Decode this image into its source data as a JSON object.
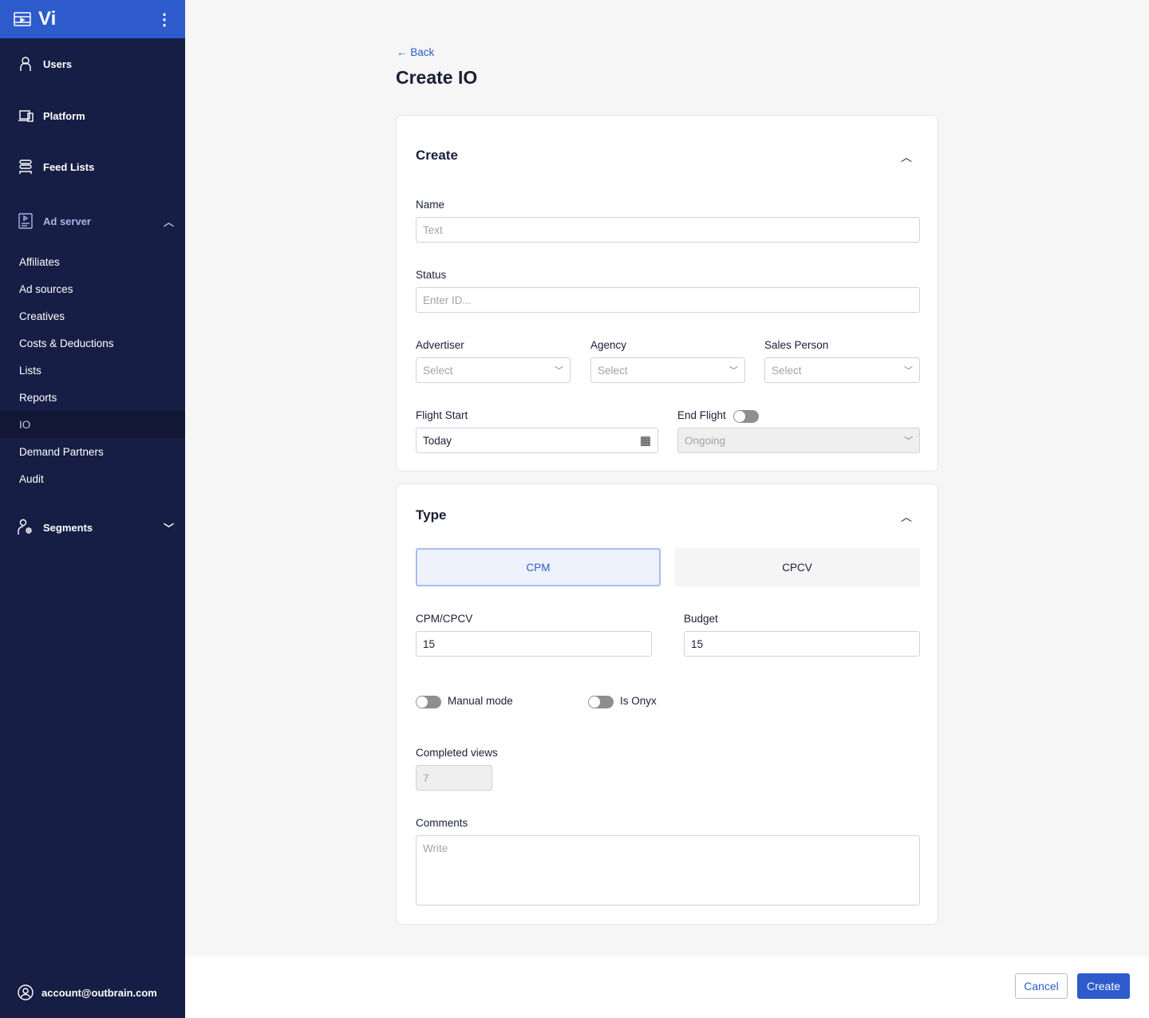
{
  "app": {
    "title": "Vi"
  },
  "sidebar": {
    "main": [
      {
        "label": "Users"
      },
      {
        "label": "Platform"
      },
      {
        "label": "Feed Lists"
      },
      {
        "label": "Ad server"
      },
      {
        "label": "Segments"
      }
    ],
    "sub": [
      "Affiliates",
      "Ad sources",
      "Creatives",
      "Costs & Deductions",
      "Lists",
      "Reports",
      "IO",
      "Demand Partners",
      "Audit"
    ],
    "active": "IO",
    "account": "account@outbrain.com"
  },
  "page": {
    "back": "← Back",
    "title": "Create IO"
  },
  "create": {
    "title": "Create",
    "name": {
      "label": "Name",
      "placeholder": "Text"
    },
    "status": {
      "label": "Status",
      "placeholder": "Enter ID..."
    },
    "advertiser": {
      "label": "Advertiser",
      "placeholder": "Select"
    },
    "agency": {
      "label": "Agency",
      "placeholder": "Select"
    },
    "sales": {
      "label": "Sales Person",
      "placeholder": "Select"
    },
    "flight_start": {
      "label": "Flight Start",
      "value": "Today"
    },
    "end_flight": {
      "label": "End Flight",
      "value": "Ongoing",
      "enabled": false
    }
  },
  "type": {
    "title": "Type",
    "options": [
      "CPM",
      "CPCV"
    ],
    "selected": "CPM",
    "cpm": {
      "label": "CPM/CPCV",
      "value": "15"
    },
    "budget": {
      "label": "Budget",
      "value": "15"
    },
    "manual": {
      "label": "Manual mode",
      "on": false
    },
    "onyx": {
      "label": "Is Onyx",
      "on": false
    },
    "completed": {
      "label": "Completed views",
      "value": "7"
    },
    "comments": {
      "label": "Comments",
      "placeholder": "Write"
    }
  },
  "footer": {
    "cancel": "Cancel",
    "create": "Create"
  },
  "colors": {
    "accent": "#2d5bcc",
    "sidebar": "#161e45"
  }
}
